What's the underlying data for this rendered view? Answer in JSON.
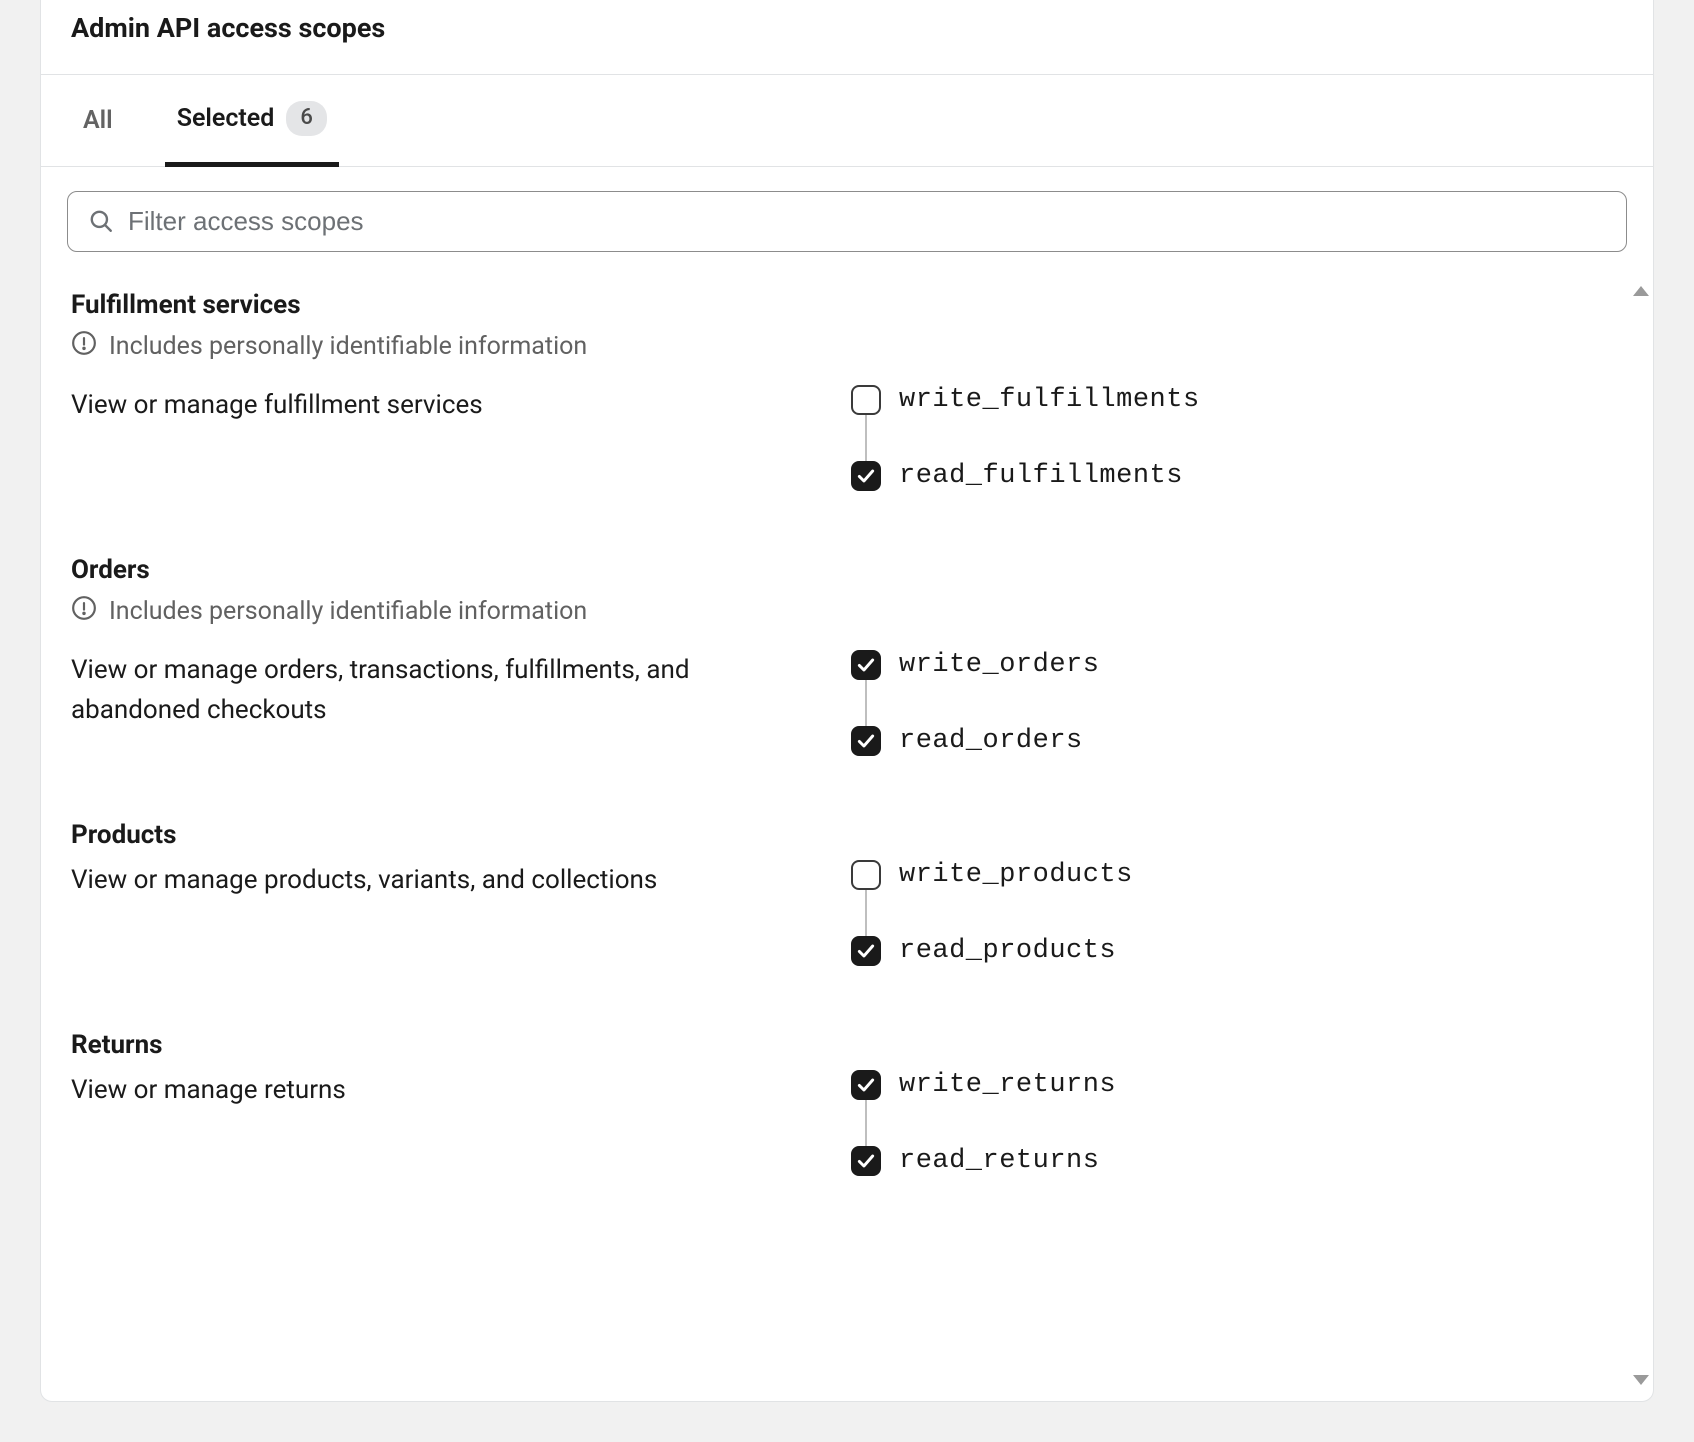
{
  "header": {
    "title": "Admin API access scopes"
  },
  "tabs": {
    "all_label": "All",
    "selected_label": "Selected",
    "selected_count": "6",
    "active": "selected"
  },
  "search": {
    "placeholder": "Filter access scopes"
  },
  "pii_text": "Includes personally identifiable information",
  "groups": [
    {
      "id": "fulfillment-services",
      "title": "Fulfillment services",
      "pii": true,
      "description": "View or manage fulfillment services",
      "scopes": [
        {
          "name": "write_fulfillments",
          "checked": false
        },
        {
          "name": "read_fulfillments",
          "checked": true
        }
      ]
    },
    {
      "id": "orders",
      "title": "Orders",
      "pii": true,
      "description": "View or manage orders, transactions, fulfillments, and abandoned checkouts",
      "scopes": [
        {
          "name": "write_orders",
          "checked": true
        },
        {
          "name": "read_orders",
          "checked": true
        }
      ]
    },
    {
      "id": "products",
      "title": "Products",
      "pii": false,
      "description": "View or manage products, variants, and collections",
      "scopes": [
        {
          "name": "write_products",
          "checked": false
        },
        {
          "name": "read_products",
          "checked": true
        }
      ]
    },
    {
      "id": "returns",
      "title": "Returns",
      "pii": false,
      "description": "View or manage returns",
      "scopes": [
        {
          "name": "write_returns",
          "checked": true
        },
        {
          "name": "read_returns",
          "checked": true
        }
      ]
    }
  ]
}
